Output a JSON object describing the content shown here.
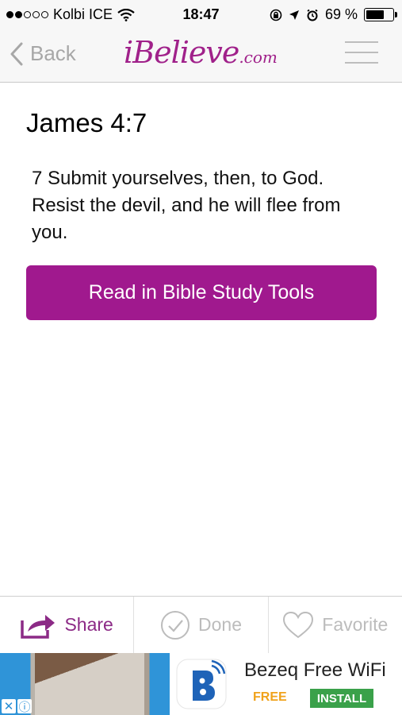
{
  "status_bar": {
    "carrier": "Kolbi ICE",
    "time": "18:47",
    "battery": "69 %",
    "signal_filled": 2,
    "signal_total": 5
  },
  "nav": {
    "back_label": "Back",
    "logo_main": "iBelieve",
    "logo_tld": ".com"
  },
  "content": {
    "reference": "James 4:7",
    "verse": "7 Submit yourselves, then, to God. Resist the devil, and he will flee from you.",
    "read_button": "Read in Bible Study Tools"
  },
  "toolbar": {
    "share": "Share",
    "done": "Done",
    "favorite": "Favorite"
  },
  "ad": {
    "title": "Bezeq Free WiFi",
    "free": "FREE",
    "install": "INSTALL"
  },
  "colors": {
    "brand_purple": "#a0198e",
    "install_green": "#3aa14a",
    "free_orange": "#f0a21b"
  }
}
